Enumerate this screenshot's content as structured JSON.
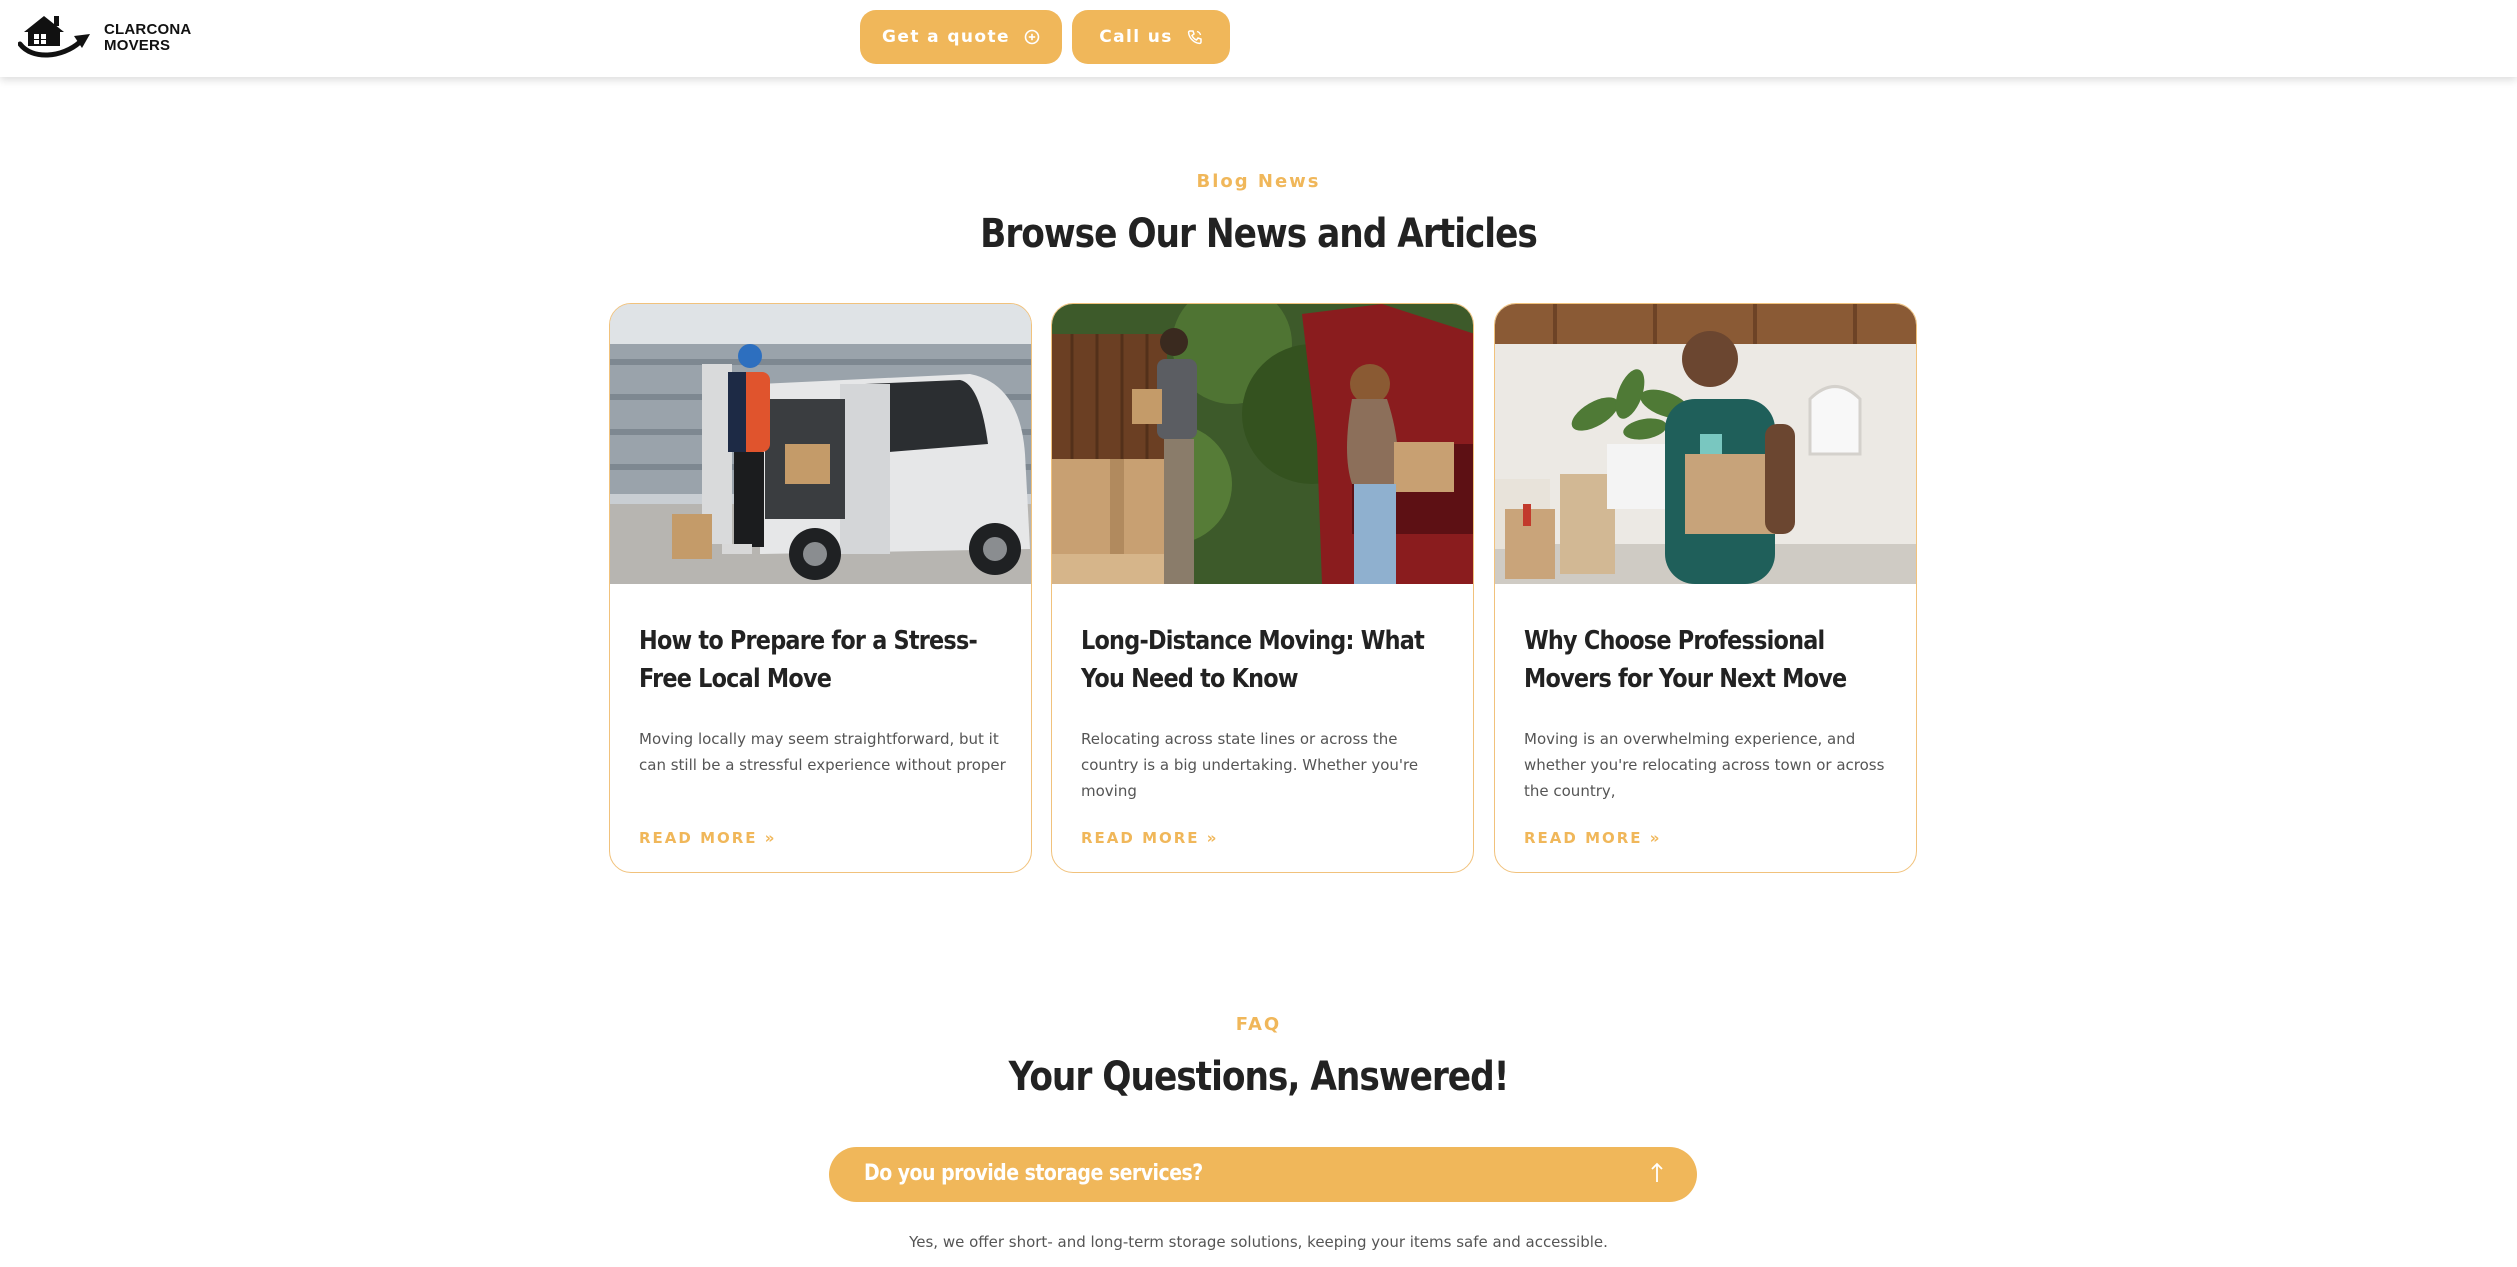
{
  "header": {
    "logo": {
      "line1": "CLARCONA",
      "line2": "MOVERS"
    },
    "quote_button": {
      "label": "Get a quote",
      "icon": "plus-circle-icon"
    },
    "call_button": {
      "label": "Call us",
      "icon": "phone-icon"
    }
  },
  "colors": {
    "accent": "#f0b75a",
    "card_border": "#f1c27c",
    "heading": "#222222",
    "body_text": "#555555"
  },
  "blog": {
    "eyebrow": "Blog News",
    "title": "Browse Our News and Articles",
    "posts": [
      {
        "title": "How to Prepare for a Stress-Free Local Move",
        "excerpt": "Moving locally may seem straightforward, but it can still be a stressful experience without proper",
        "read_more": "READ MORE »",
        "image": "photo-mover-loading-van"
      },
      {
        "title": "Long-Distance Moving: What You Need to Know",
        "excerpt": "Relocating across state lines or across the country is a big undertaking. Whether you're moving",
        "read_more": "READ MORE »",
        "image": "photo-couple-loading-car"
      },
      {
        "title": "Why Choose Professional Movers for Your Next Move",
        "excerpt": "Moving is an overwhelming experience, and whether you're relocating across town or across the country,",
        "read_more": "READ MORE »",
        "image": "photo-man-carrying-box-and-plant"
      }
    ]
  },
  "faq": {
    "eyebrow": "FAQ",
    "title": "Your Questions, Answered!",
    "items": [
      {
        "question": "Do you provide storage services?",
        "answer": "Yes, we offer short- and long-term storage solutions, keeping your items safe and accessible.",
        "icon": "arrow-up-icon"
      }
    ]
  }
}
